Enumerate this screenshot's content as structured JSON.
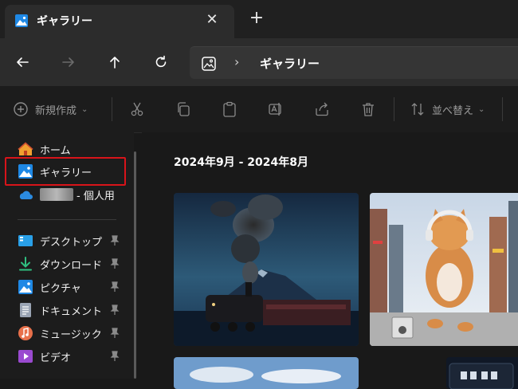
{
  "tab": {
    "title": "ギャラリー",
    "close": "✕",
    "new": "+"
  },
  "address": {
    "separator": "›",
    "location": "ギャラリー"
  },
  "toolbar": {
    "new_label": "新規作成",
    "sort_label": "並べ替え"
  },
  "sidebar": {
    "items": [
      {
        "label": "ホーム",
        "icon": "home-icon"
      },
      {
        "label": "ギャラリー",
        "icon": "gallery-icon"
      },
      {
        "label": "- 個人用",
        "icon": "onedrive-cloud-icon"
      },
      {
        "label": "デスクトップ",
        "icon": "desktop-icon"
      },
      {
        "label": "ダウンロード",
        "icon": "download-icon"
      },
      {
        "label": "ピクチャ",
        "icon": "pictures-icon"
      },
      {
        "label": "ドキュメント",
        "icon": "documents-icon"
      },
      {
        "label": "ミュージック",
        "icon": "music-icon"
      },
      {
        "label": "ビデオ",
        "icon": "video-icon"
      }
    ]
  },
  "gallery": {
    "date_range": "2024年9月 - 2024年8月"
  },
  "colors": {
    "highlight_border": "#d8141a",
    "accent": "#4aa3f0"
  }
}
